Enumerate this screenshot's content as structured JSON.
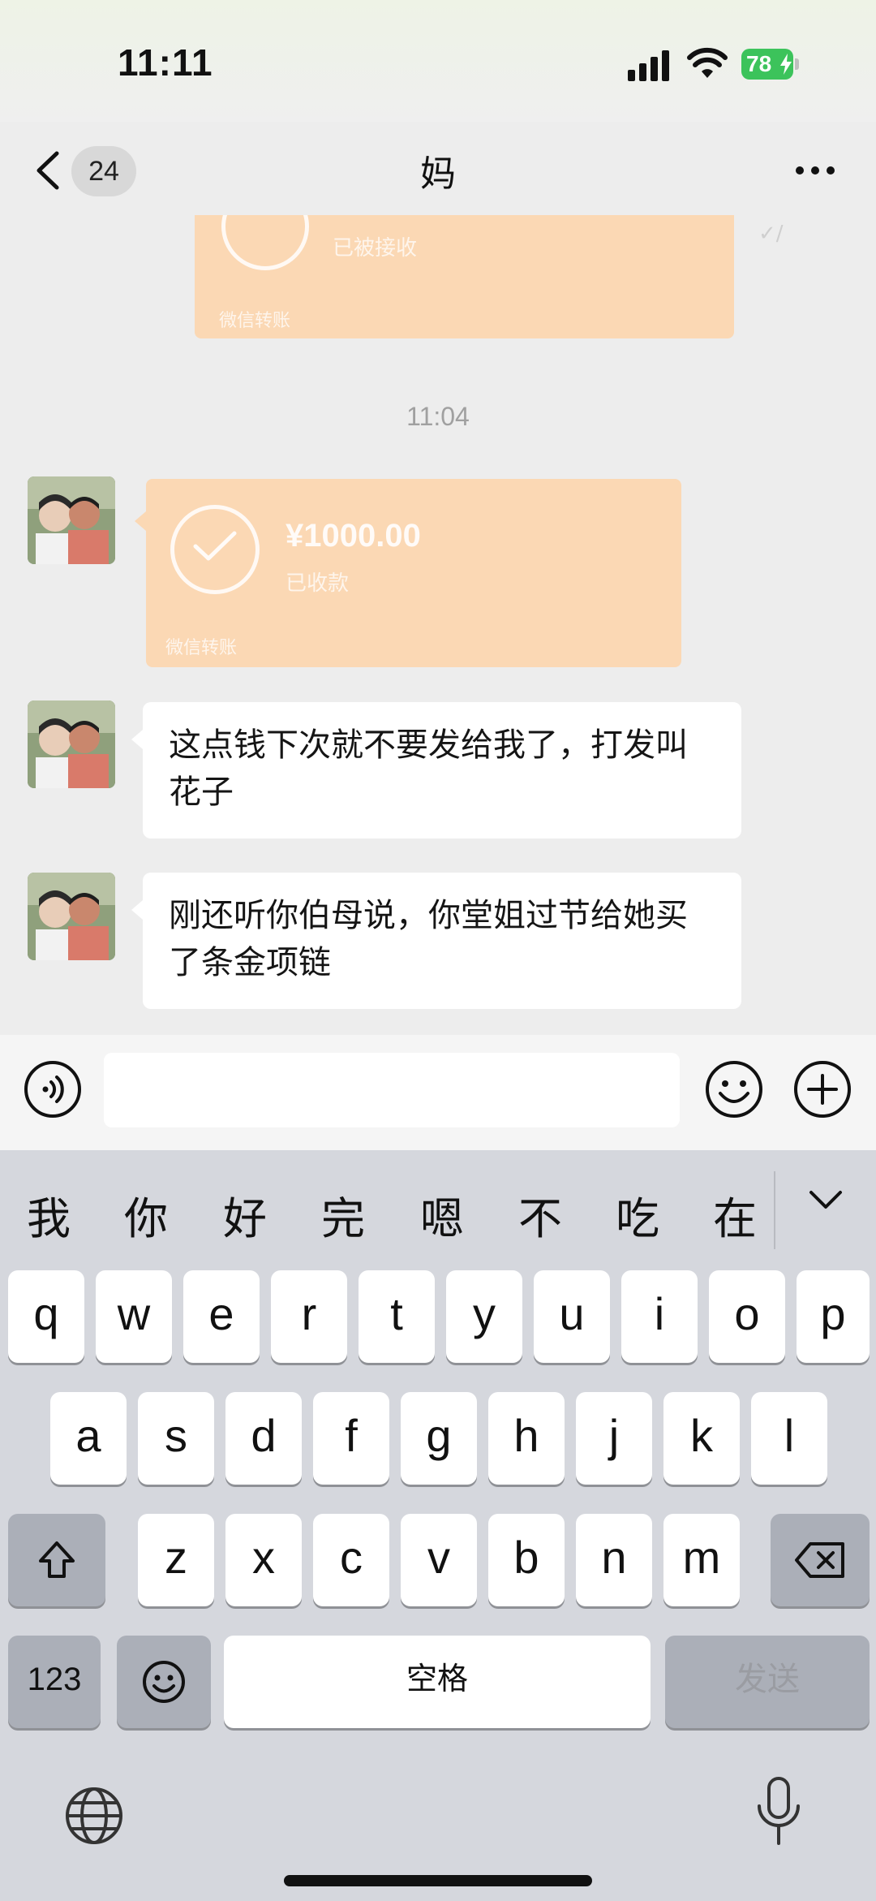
{
  "status_bar": {
    "time": "11:11",
    "battery": "78"
  },
  "nav": {
    "unread_count": "24",
    "title": "妈"
  },
  "messages": {
    "prev_transfer": {
      "status": "已被接收",
      "footer": "微信转账",
      "read_tick": "✓/"
    },
    "time_label": "11:04",
    "transfer": {
      "amount": "¥1000.00",
      "status": "已收款",
      "footer": "微信转账"
    },
    "bubbles": [
      "这点钱下次就不要发给我了，打发叫花子",
      "刚还听你伯母说，你堂姐过节给她买了条金项链"
    ]
  },
  "input": {
    "placeholder": ""
  },
  "keyboard": {
    "candidates": [
      "我",
      "你",
      "好",
      "完",
      "嗯",
      "不",
      "吃",
      "在"
    ],
    "row1": [
      "q",
      "w",
      "e",
      "r",
      "t",
      "y",
      "u",
      "i",
      "o",
      "p"
    ],
    "row2": [
      "a",
      "s",
      "d",
      "f",
      "g",
      "h",
      "j",
      "k",
      "l"
    ],
    "row3": [
      "z",
      "x",
      "c",
      "v",
      "b",
      "n",
      "m"
    ],
    "numbers_label": "123",
    "space_label": "空格",
    "send_label": "发送"
  },
  "colors": {
    "background": "#ededed",
    "transfer_card": "#fbd8b4",
    "bubble": "#ffffff",
    "keyboard": "#d5d7dd",
    "battery": "#3cc35b"
  }
}
